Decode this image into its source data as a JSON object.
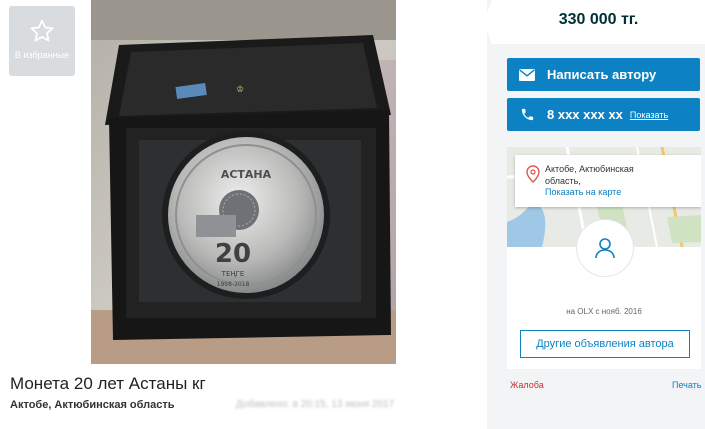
{
  "favorites": {
    "label": "В избранные",
    "icon": "star-outline-icon"
  },
  "listing": {
    "title": "Монета 20 лет Астаны кг",
    "location": "Актобе, Актюбинская область",
    "added_blurred": "Добавлено: в 20:15, 13 июня 2017"
  },
  "photo": {
    "coin_top_text": "АСТАНА",
    "coin_number": "20",
    "coin_years": "1998-2018",
    "coin_currency": "ТЕҢГЕ"
  },
  "price": "330 000 тг.",
  "contact": {
    "message_label": "Написать автору",
    "message_icon": "envelope-icon",
    "phone_number": "8 xxx xxx xx",
    "phone_show": "Показать",
    "phone_icon": "phone-icon"
  },
  "seller": {
    "city": "Актобе, Актюбинская",
    "region": "область,",
    "show_on_map": "Показать на карте",
    "since": "на OLX с нояб. 2016",
    "other_ads": "Другие объявления автора"
  },
  "footer": {
    "complain": "Жалоба",
    "print": "Печать"
  },
  "colors": {
    "accent": "#0c82c4",
    "price_text": "#002f34",
    "complain": "#d02c2c"
  }
}
